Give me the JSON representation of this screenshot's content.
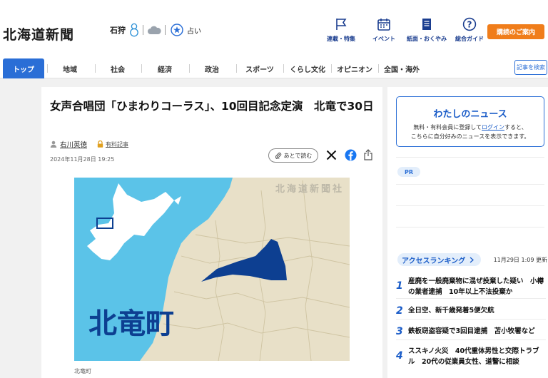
{
  "header": {
    "logo": "北海道新聞",
    "weather_city": "石狩",
    "fortune_label": "占い",
    "nav": [
      {
        "label": "連載・特集",
        "icon": "flag-icon"
      },
      {
        "label": "イベント",
        "icon": "calendar-icon"
      },
      {
        "label": "紙面・おくやみ",
        "icon": "newspaper-icon"
      },
      {
        "label": "総合ガイド",
        "icon": "help-circle-icon"
      }
    ],
    "login_label": "購読のご案内"
  },
  "categories": [
    "トップ",
    "地域",
    "社会",
    "経済",
    "政治",
    "スポーツ",
    "くらし文化",
    "オピニオン",
    "全国・海外"
  ],
  "search_label": "記事を検索",
  "article": {
    "title": "女声合唱団「ひまわりコーラス」、10回目記念定演　北竜で30日",
    "author": "右川英徳",
    "paid_label": "有料記事",
    "date": "2024年11月28日 19:25",
    "read_later": "あとで読む",
    "map": {
      "watermark": "北海道新聞社",
      "town": "北竜町",
      "colors": {
        "sea": "#5bc3e8",
        "land": "#e8e0c8",
        "town": "#0d3f91"
      }
    },
    "caption": "北竜町"
  },
  "sidebar": {
    "mynews_title": "わたしのニュース",
    "mynews_line1_a": "無料・有料会員に登録して",
    "mynews_login": "ログイン",
    "mynews_line1_b": "すると、",
    "mynews_line2": "こちらに自分好みのニュースを表示できます。",
    "pr_label": "PR",
    "ranking_title": "アクセスランキング",
    "ranking_time": "11月29日 1:09 更新",
    "ranking": [
      {
        "rank": "1",
        "text": "産廃を一般廃棄物に混ぜ投棄した疑い　小樽の業者逮捕　10年以上不法投棄か"
      },
      {
        "rank": "2",
        "text": "全日空、新千歳発着5便欠航"
      },
      {
        "rank": "3",
        "text": "鉄板窃盗容疑で3回目逮捕　苫小牧署など"
      },
      {
        "rank": "4",
        "text": "ススキノ火災　40代重体男性と交際トラブル　20代の従業員女性、道警に相談"
      }
    ]
  }
}
